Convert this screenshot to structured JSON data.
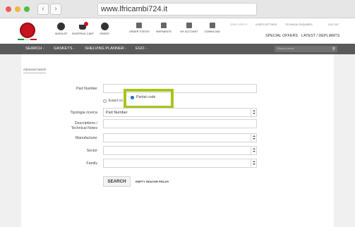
{
  "browser": {
    "url": "www.lfricambi724.it"
  },
  "header": {
    "icons": [
      {
        "label": "WISHLIST",
        "icon": "wishlist-icon"
      },
      {
        "label": "SHOPPING CART",
        "icon": "shopping-cart-icon"
      },
      {
        "label": "ORDER",
        "icon": "order-icon"
      },
      {
        "label": "ORDER STATUS",
        "icon": "order-status-icon"
      },
      {
        "label": "SHIPMENTS",
        "icon": "truck-icon"
      },
      {
        "label": "MY ACCOUNT",
        "icon": "account-icon"
      },
      {
        "label": "DOWNLOAD",
        "icon": "download-icon"
      }
    ],
    "toplinks": {
      "user": "DEMO USER LF",
      "user_settings": "USER'S SETTINGS",
      "tech": "TECHNICAL ENQUIRIES",
      "logout": "LOG OUT"
    },
    "sublinks": {
      "offers": "SPECIAL OFFERS",
      "latest": "LATEST / DEPLIANTS"
    }
  },
  "menu": {
    "items": [
      "SEARCH -",
      "GASKETS -",
      "SHELVING PLANNER -",
      "EGO -"
    ],
    "search_placeholder": "Ricerca veloce"
  },
  "form": {
    "advanced_link": "Advanced search",
    "part_number_label": "Part Number",
    "part_number_value": "",
    "radio_exact": "Exact co",
    "radio_partial": "Partial code",
    "tipologia_label": "Tipologia ricerca",
    "tipologia_value": "Part Number",
    "desc_label_1": "Descriptions /",
    "desc_label_2": "Technical Notes",
    "manufacturer_label": "Manufacturer",
    "sector_label": "Sector",
    "family_label": "Family",
    "search_button": "SEARCH",
    "empty_link": "EMPTY SEACHR FIELDS"
  },
  "colors": {
    "highlight": "#a6c520",
    "menubar": "#5a5a5a",
    "brand_red": "#c8141e"
  }
}
